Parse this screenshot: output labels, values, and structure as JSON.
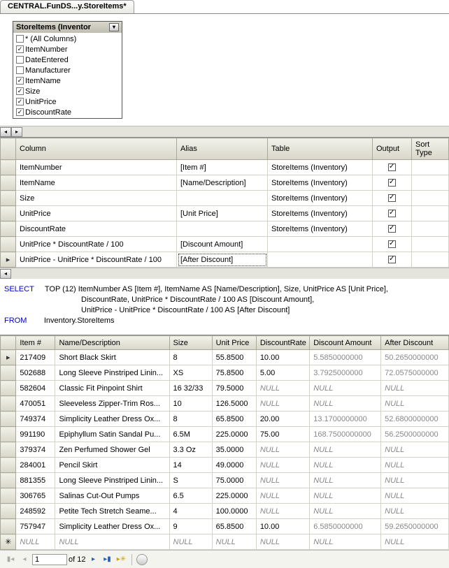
{
  "tab": {
    "title": "CENTRAL.FunDS...y.StoreItems*"
  },
  "diagram": {
    "table_title": "StoreItems (Inventor",
    "columns": [
      {
        "label": "* (All Columns)",
        "checked": false
      },
      {
        "label": "ItemNumber",
        "checked": true
      },
      {
        "label": "DateEntered",
        "checked": false
      },
      {
        "label": "Manufacturer",
        "checked": false
      },
      {
        "label": "ItemName",
        "checked": true
      },
      {
        "label": "Size",
        "checked": true
      },
      {
        "label": "UnitPrice",
        "checked": true
      },
      {
        "label": "DiscountRate",
        "checked": true
      }
    ]
  },
  "criteria": {
    "headers": [
      "Column",
      "Alias",
      "Table",
      "Output",
      "Sort Type"
    ],
    "rows": [
      {
        "column": "ItemNumber",
        "alias": "[Item #]",
        "table": "StoreItems (Inventory)",
        "output": true
      },
      {
        "column": "ItemName",
        "alias": "[Name/Description]",
        "table": "StoreItems (Inventory)",
        "output": true
      },
      {
        "column": "Size",
        "alias": "",
        "table": "StoreItems (Inventory)",
        "output": true
      },
      {
        "column": "UnitPrice",
        "alias": "[Unit Price]",
        "table": "StoreItems (Inventory)",
        "output": true
      },
      {
        "column": "DiscountRate",
        "alias": "",
        "table": "StoreItems (Inventory)",
        "output": true
      },
      {
        "column": "UnitPrice * DiscountRate / 100",
        "alias": "[Discount Amount]",
        "table": "",
        "output": true
      },
      {
        "column": "UnitPrice - UnitPrice * DiscountRate / 100",
        "alias": "[After Discount]",
        "table": "",
        "output": true,
        "current": true
      }
    ]
  },
  "sql": {
    "select_kw": "SELECT",
    "from_kw": "FROM",
    "line1": "TOP (12) ItemNumber AS [Item #], ItemName AS [Name/Description], Size, UnitPrice AS [Unit Price],",
    "line2": "DiscountRate, UnitPrice * DiscountRate / 100 AS [Discount Amount],",
    "line3": "UnitPrice - UnitPrice * DiscountRate / 100 AS [After Discount]",
    "from_line": "Inventory.StoreItems"
  },
  "results": {
    "headers": [
      "Item #",
      "Name/Description",
      "Size",
      "Unit Price",
      "DiscountRate",
      "Discount Amount",
      "After Discount"
    ],
    "rows": [
      {
        "cur": true,
        "c": [
          "217409",
          "Short Black Skirt",
          "8",
          "55.8500",
          "10.00",
          "5.5850000000",
          "50.2650000000"
        ]
      },
      {
        "c": [
          "502688",
          "Long Sleeve Pinstriped Linin...",
          "XS",
          "75.8500",
          "5.00",
          "3.7925000000",
          "72.0575000000"
        ]
      },
      {
        "c": [
          "582604",
          "Classic Fit Pinpoint Shirt",
          "16 32/33",
          "79.5000",
          "NULL",
          "NULL",
          "NULL"
        ]
      },
      {
        "c": [
          "470051",
          "Sleeveless Zipper-Trim Ros...",
          "10",
          "126.5000",
          "NULL",
          "NULL",
          "NULL"
        ]
      },
      {
        "c": [
          "749374",
          "Simplicity Leather Dress Ox...",
          "8",
          "65.8500",
          "20.00",
          "13.1700000000",
          "52.6800000000"
        ]
      },
      {
        "c": [
          "991190",
          "Epiphyllum Satin Sandal Pu...",
          "6.5M",
          "225.0000",
          "75.00",
          "168.7500000000",
          "56.2500000000"
        ]
      },
      {
        "c": [
          "379374",
          "Zen Perfumed Shower Gel",
          "3.3 Oz",
          "35.0000",
          "NULL",
          "NULL",
          "NULL"
        ]
      },
      {
        "c": [
          "284001",
          "Pencil Skirt",
          "14",
          "49.0000",
          "NULL",
          "NULL",
          "NULL"
        ]
      },
      {
        "c": [
          "881355",
          "Long Sleeve Pinstriped Linin...",
          "S",
          "75.0000",
          "NULL",
          "NULL",
          "NULL"
        ]
      },
      {
        "c": [
          "306765",
          "Salinas Cut-Out Pumps",
          "6.5",
          "225.0000",
          "NULL",
          "NULL",
          "NULL"
        ]
      },
      {
        "c": [
          "248592",
          "Petite Tech Stretch Seame...",
          "4",
          "100.0000",
          "NULL",
          "NULL",
          "NULL"
        ]
      },
      {
        "c": [
          "757947",
          "Simplicity Leather Dress Ox...",
          "9",
          "65.8500",
          "10.00",
          "6.5850000000",
          "59.2650000000"
        ]
      },
      {
        "new": true,
        "c": [
          "NULL",
          "NULL",
          "NULL",
          "NULL",
          "NULL",
          "NULL",
          "NULL"
        ]
      }
    ]
  },
  "pager": {
    "current": "1",
    "of_text": "of 12"
  }
}
